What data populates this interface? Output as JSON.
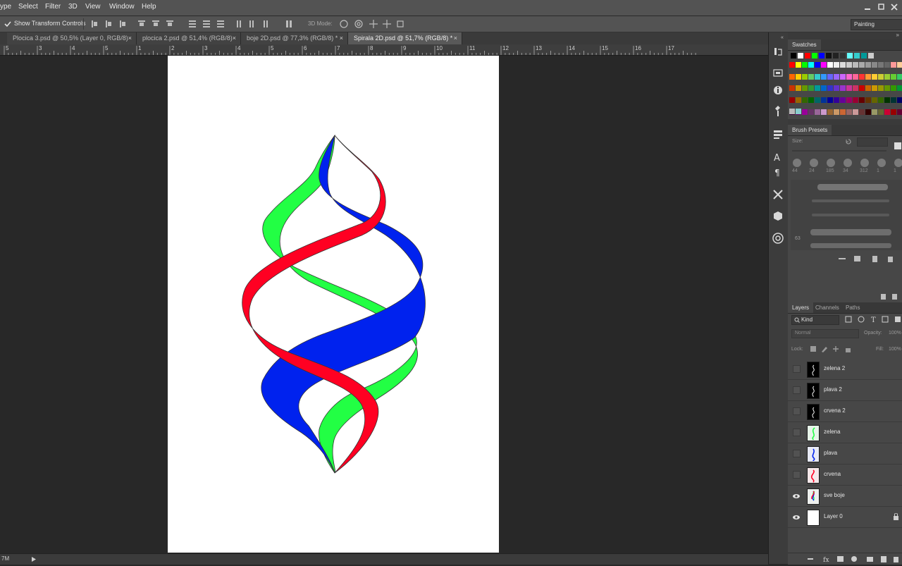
{
  "menubar": {
    "items": [
      "ype",
      "Select",
      "Filter",
      "3D",
      "View",
      "Window",
      "Help"
    ]
  },
  "workspace": {
    "label": "Painting"
  },
  "options": {
    "show_transform_label": "Show Transform Controls",
    "mode_label": "3D Mode:"
  },
  "tabs": [
    {
      "label": "Plocica 3.psd @ 50,5% (Layer 0, RGB/8)",
      "active": false
    },
    {
      "label": "plocica 2.psd @ 51,4% (RGB/8)",
      "active": false
    },
    {
      "label": "boje 2D.psd @ 77,3% (RGB/8) *",
      "active": false
    },
    {
      "label": "Spirala 2D.psd @ 51,7% (RGB/8) *",
      "active": true
    }
  ],
  "ruler": {
    "labels": [
      "5",
      "3",
      "4",
      "5",
      "1",
      "2",
      "3",
      "4",
      "5",
      "6",
      "7",
      "8",
      "9",
      "10",
      "11",
      "12",
      "13",
      "14",
      "15",
      "16",
      "17"
    ]
  },
  "status": {
    "zoom": "7M"
  },
  "swatches": {
    "title": "Swatches",
    "row0": [
      "#000000",
      "#ffffff",
      "#ff0000",
      "#00ff00",
      "#0000ff",
      "#111111",
      "#222222",
      "#333333",
      "#66ffff",
      "#33cccc",
      "#009999",
      "#cccccc"
    ],
    "rows": [
      [
        "#ff0000",
        "#ffff00",
        "#00ff00",
        "#00ffff",
        "#0000ff",
        "#ff00ff",
        "#ffffff",
        "#eeeeee",
        "#dddddd",
        "#cccccc",
        "#bbbbbb",
        "#aaaaaa",
        "#999999",
        "#888888",
        "#777777",
        "#666666",
        "#ff9999",
        "#ffcc99",
        "#ffff99"
      ],
      [
        "#ff6600",
        "#ffcc00",
        "#99cc00",
        "#66cc66",
        "#33cccc",
        "#3399ff",
        "#6666ff",
        "#9966ff",
        "#cc66ff",
        "#ff66cc",
        "#ff6699",
        "#ff3333",
        "#ff9933",
        "#ffcc33",
        "#cccc33",
        "#99cc33",
        "#66cc33",
        "#33cc66",
        "#33cc99"
      ],
      [
        "#cc3300",
        "#cc9900",
        "#669900",
        "#339933",
        "#009999",
        "#0066cc",
        "#3333cc",
        "#6633cc",
        "#9933cc",
        "#cc3399",
        "#cc3366",
        "#cc0000",
        "#cc6600",
        "#cc9900",
        "#999900",
        "#669900",
        "#339900",
        "#009933",
        "#009966"
      ],
      [
        "#990000",
        "#996600",
        "#336600",
        "#006600",
        "#006666",
        "#003399",
        "#000099",
        "#330099",
        "#660099",
        "#990066",
        "#990033",
        "#660000",
        "#663300",
        "#666600",
        "#336600",
        "#003300",
        "#003333",
        "#000066",
        "#330066"
      ],
      [
        "#330033",
        "#660066",
        "#990099",
        "#663366",
        "#996699",
        "#cc99cc",
        "#996633",
        "#cc9966",
        "#cc6633",
        "#996666",
        "#cc9999",
        "#663333",
        "#330000",
        "#999966",
        "#666633",
        "#cc0033",
        "#990000",
        "#660033",
        "#330000"
      ]
    ],
    "last": [
      "#bbbbbb",
      "#88cccc"
    ]
  },
  "brush_presets": {
    "title": "Brush Presets",
    "size_label": "Size:",
    "sizes": [
      "44",
      "24",
      "185",
      "34",
      "312",
      "1",
      "1"
    ],
    "stroke_numbers": [
      "63"
    ]
  },
  "layers_panel": {
    "tabs": [
      "Layers",
      "Channels",
      "Paths"
    ],
    "filter_label": "Kind",
    "blend_mode": "Normal",
    "opacity_label": "Opacity:",
    "opacity_value": "100%",
    "lock_label": "Lock:",
    "fill_label": "Fill:",
    "fill_value": "100%",
    "layers": [
      {
        "name": "zelena 2",
        "visible": false,
        "thumb": "dark"
      },
      {
        "name": "plava 2",
        "visible": false,
        "thumb": "dark"
      },
      {
        "name": "crvena 2",
        "visible": false,
        "thumb": "dark"
      },
      {
        "name": "zelena",
        "visible": false,
        "thumb": "checker-green"
      },
      {
        "name": "plava",
        "visible": false,
        "thumb": "checker-blue"
      },
      {
        "name": "crvena",
        "visible": false,
        "thumb": "checker-red"
      },
      {
        "name": "sve boje",
        "visible": true,
        "thumb": "checker-all"
      },
      {
        "name": "Layer 0",
        "visible": true,
        "thumb": "white",
        "locked": true
      }
    ]
  },
  "artwork": {
    "ribbon_colors": {
      "green": "#22ff44",
      "blue": "#0022ee",
      "red": "#ff0022"
    }
  }
}
